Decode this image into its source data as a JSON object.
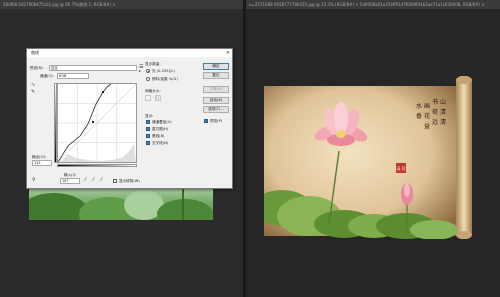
{
  "tabs": {
    "left": "58df06 0d27908475cb1.jpg @ 66.7%(曲线 1, RGB/8#) ×",
    "right": "u=2571688 0658777786455.jpg @ 33.3% (RGB/8#) × 5d0008a01a354ff91d7f008ff44b3aa71a1c630008, RGB/8#) ×"
  },
  "dialog": {
    "title": "曲线",
    "close": "×",
    "preset_label": "预设(R):",
    "preset_value": "自定",
    "channel_label": "通道(C):",
    "channel_value": "RGB",
    "output_label": "输出(O):",
    "output_value": "115",
    "input_label": "输入(I):",
    "input_value": "107",
    "show_clipping": "显示修剪(W)",
    "display_amount": "显示数量:",
    "light": "光 (0-255)(L)",
    "pigment": "颜料/油墨 %(G)",
    "grid_size": "网格大小:",
    "show": "显示:",
    "channel_overlays": "通道叠加(V)",
    "histogram": "直方图(H)",
    "baseline": "基线(B)",
    "intersection": "交叉线(N)",
    "ok": "确定",
    "reset": "复位",
    "smooth": "平滑(M)",
    "auto": "自动(A)",
    "options": "选项(T)...",
    "preview": "预览(P)"
  },
  "poem": [
    "书",
    "画",
    "山",
    "水",
    "荷",
    "花",
    "清",
    "香",
    "远",
    "益",
    "清"
  ],
  "seal": "清 荷"
}
